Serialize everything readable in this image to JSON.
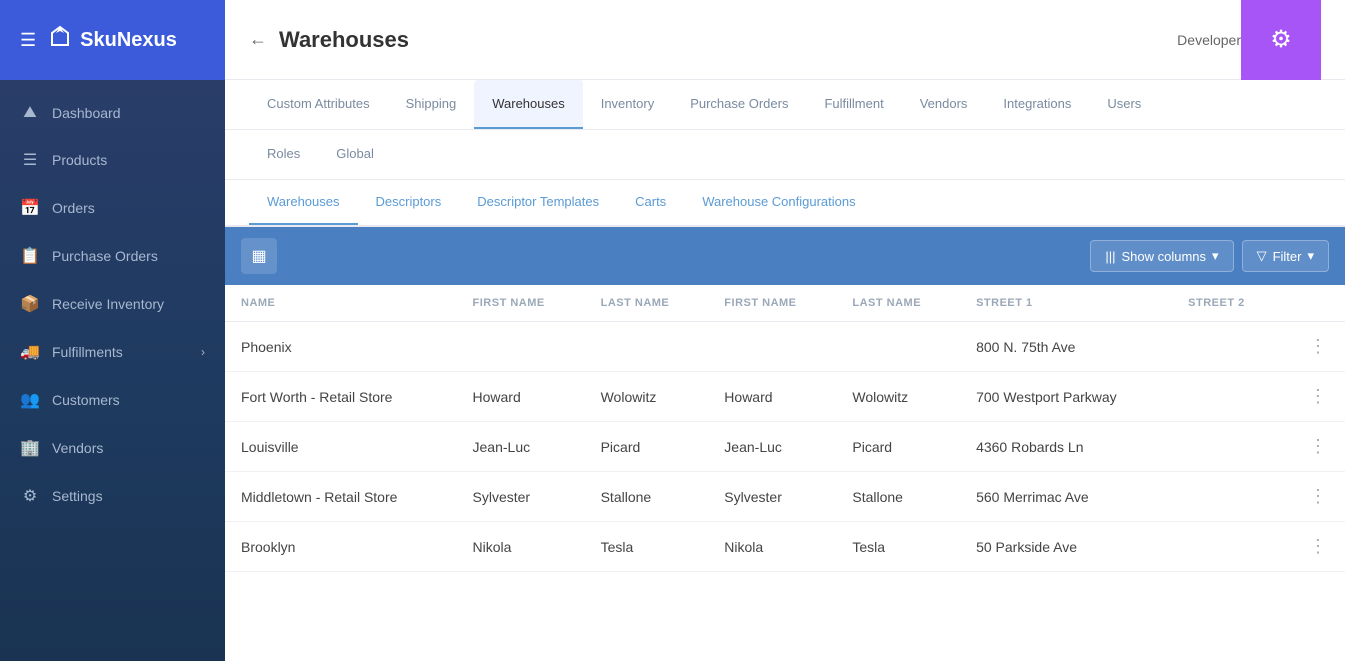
{
  "sidebar": {
    "logo": "SkuNexus",
    "nav_items": [
      {
        "id": "dashboard",
        "label": "Dashboard",
        "icon": "⛰",
        "has_chevron": false
      },
      {
        "id": "products",
        "label": "Products",
        "icon": "☰",
        "has_chevron": false
      },
      {
        "id": "orders",
        "label": "Orders",
        "icon": "📅",
        "has_chevron": false
      },
      {
        "id": "purchase-orders",
        "label": "Purchase Orders",
        "icon": "📋",
        "has_chevron": false
      },
      {
        "id": "receive-inventory",
        "label": "Receive Inventory",
        "icon": "📦",
        "has_chevron": false
      },
      {
        "id": "fulfillments",
        "label": "Fulfillments",
        "icon": "🚚",
        "has_chevron": true
      },
      {
        "id": "customers",
        "label": "Customers",
        "icon": "👥",
        "has_chevron": false
      },
      {
        "id": "vendors",
        "label": "Vendors",
        "icon": "🏢",
        "has_chevron": false
      },
      {
        "id": "settings",
        "label": "Settings",
        "icon": "⚙",
        "has_chevron": false
      }
    ]
  },
  "topbar": {
    "back_label": "←",
    "title": "Warehouses",
    "user_label": "Developer",
    "gear_icon": "⚙"
  },
  "tabs": {
    "row1": [
      {
        "id": "custom-attributes",
        "label": "Custom Attributes",
        "active": false
      },
      {
        "id": "shipping",
        "label": "Shipping",
        "active": false
      },
      {
        "id": "warehouses",
        "label": "Warehouses",
        "active": true
      },
      {
        "id": "inventory",
        "label": "Inventory",
        "active": false
      },
      {
        "id": "purchase-orders",
        "label": "Purchase Orders",
        "active": false
      },
      {
        "id": "fulfillment",
        "label": "Fulfillment",
        "active": false
      },
      {
        "id": "vendors",
        "label": "Vendors",
        "active": false
      },
      {
        "id": "integrations",
        "label": "Integrations",
        "active": false
      },
      {
        "id": "users",
        "label": "Users",
        "active": false
      }
    ],
    "row2": [
      {
        "id": "roles",
        "label": "Roles",
        "active": false
      },
      {
        "id": "global",
        "label": "Global",
        "active": false
      }
    ],
    "subtabs": [
      {
        "id": "warehouses",
        "label": "Warehouses",
        "active": true
      },
      {
        "id": "descriptors",
        "label": "Descriptors",
        "active": false
      },
      {
        "id": "descriptor-templates",
        "label": "Descriptor Templates",
        "active": false
      },
      {
        "id": "carts",
        "label": "Carts",
        "active": false
      },
      {
        "id": "warehouse-configurations",
        "label": "Warehouse Configurations",
        "active": false
      }
    ]
  },
  "toolbar": {
    "show_columns_label": "Show columns",
    "filter_label": "Filter",
    "table_icon": "▦"
  },
  "table": {
    "columns": [
      {
        "id": "name",
        "label": "NAME"
      },
      {
        "id": "first_name",
        "label": "FIRST NAME"
      },
      {
        "id": "last_name",
        "label": "LAST NAME"
      },
      {
        "id": "first_name2",
        "label": "FIRST NAME"
      },
      {
        "id": "last_name2",
        "label": "LAST NAME"
      },
      {
        "id": "street1",
        "label": "STREET 1"
      },
      {
        "id": "street2",
        "label": "STREET 2"
      }
    ],
    "rows": [
      {
        "name": "Phoenix",
        "first_name": "",
        "last_name": "",
        "first_name2": "",
        "last_name2": "",
        "street1": "800 N. 75th Ave",
        "street2": ""
      },
      {
        "name": "Fort Worth - Retail Store",
        "first_name": "Howard",
        "last_name": "Wolowitz",
        "first_name2": "Howard",
        "last_name2": "Wolowitz",
        "street1": "700 Westport Parkway",
        "street2": ""
      },
      {
        "name": "Louisville",
        "first_name": "Jean-Luc",
        "last_name": "Picard",
        "first_name2": "Jean-Luc",
        "last_name2": "Picard",
        "street1": "4360 Robards Ln",
        "street2": ""
      },
      {
        "name": "Middletown - Retail Store",
        "first_name": "Sylvester",
        "last_name": "Stallone",
        "first_name2": "Sylvester",
        "last_name2": "Stallone",
        "street1": "560 Merrimac Ave",
        "street2": ""
      },
      {
        "name": "Brooklyn",
        "first_name": "Nikola",
        "last_name": "Tesla",
        "first_name2": "Nikola",
        "last_name2": "Tesla",
        "street1": "50 Parkside Ave",
        "street2": ""
      }
    ]
  }
}
